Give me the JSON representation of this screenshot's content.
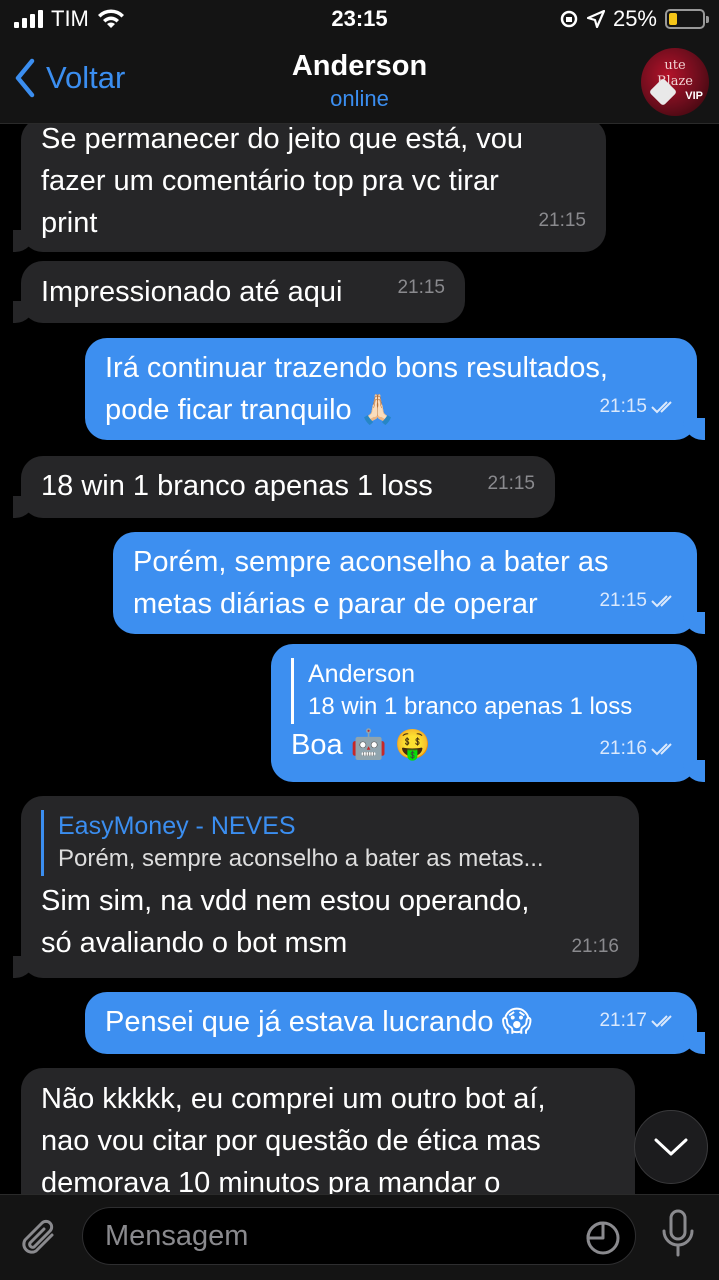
{
  "status_bar": {
    "carrier": "TIM",
    "time": "23:15",
    "battery": "25%",
    "battery_level": 0.25
  },
  "header": {
    "back_label": "Voltar",
    "contact_name": "Anderson",
    "contact_status": "online",
    "avatar_text_line1": "ute",
    "avatar_text_line2": "Blaze",
    "avatar_text_line3": "VIP"
  },
  "messages": [
    {
      "direction": "in",
      "text": "Se permanecer do jeito que está, vou\nfazer um comentário top pra vc tirar\nprint",
      "time": "21:15"
    },
    {
      "direction": "in",
      "text": "Impressionado até aqui",
      "time": "21:15"
    },
    {
      "direction": "out",
      "text": "Irá continuar trazendo bons resultados,\npode ficar tranquilo 🙏🏻",
      "time": "21:15"
    },
    {
      "direction": "in",
      "text": "18 win 1 branco apenas 1 loss",
      "time": "21:15"
    },
    {
      "direction": "out",
      "text": "Porém, sempre aconselho a bater as\nmetas diárias e parar de operar",
      "time": "21:15"
    },
    {
      "direction": "out",
      "reply_name": "Anderson",
      "reply_text": "18 win 1 branco apenas 1 loss",
      "text": "Boa 🤖 🤑",
      "time": "21:16"
    },
    {
      "direction": "in",
      "reply_name": "EasyMoney - NEVES",
      "reply_text": "Porém, sempre aconselho a bater as metas...",
      "text": "Sim sim, na vdd nem estou operando,\nsó avaliando o bot msm",
      "time": "21:16"
    },
    {
      "direction": "out",
      "text": "Pensei que já estava lucrando 😱",
      "time": "21:17"
    },
    {
      "direction": "in",
      "text": "Não kkkkk, eu comprei um outro bot aí,\nnao vou citar por questão de ética mas\ndemorava 10 minutos pra mandar o"
    }
  ],
  "input": {
    "placeholder": "Mensagem"
  },
  "colors": {
    "accent": "#3b8ef0",
    "outgoing_bubble": "#3d8ff0",
    "incoming_bubble": "#262628"
  }
}
